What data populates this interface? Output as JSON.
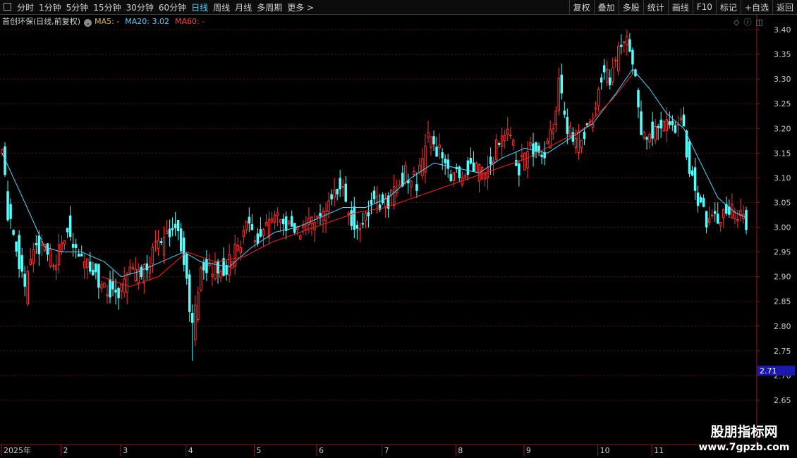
{
  "toolbar": {
    "timeframes": [
      "分时",
      "1分钟",
      "5分钟",
      "15分钟",
      "30分钟",
      "60分钟",
      "日线",
      "周线",
      "月线",
      "多周期",
      "更多 >"
    ],
    "active_timeframe": "日线",
    "right_buttons": [
      "复权",
      "叠加",
      "多股",
      "统计",
      "画线",
      "F10",
      "标记",
      "+自选",
      "返回"
    ]
  },
  "legend": {
    "title": "首创环保(日线,前复权)",
    "ma5": "MA5: -",
    "ma20": "MA20: 3.02",
    "ma60": "MA60: -"
  },
  "colors": {
    "up": "#ff3232",
    "down": "#54ffff",
    "ma20": "#4fd4ff",
    "ma60": "#ff2020",
    "axis": "#8b2020",
    "price_tag": "#1a1ab0"
  },
  "icons": [
    "menu-icon",
    "toggle-icon",
    "diamond-icon",
    "info-icon",
    "expand-icon"
  ],
  "watermark": {
    "line1": "股朋指标网",
    "line2": "www.7gpzb.com"
  },
  "chart_data": {
    "type": "candlestick",
    "title": "首创环保(日线,前复权)",
    "ylim": [
      2.6,
      3.42
    ],
    "yticks": [
      "3.40",
      "3.35",
      "3.30",
      "3.25",
      "3.20",
      "3.15",
      "3.10",
      "3.05",
      "3.00",
      "2.95",
      "2.90",
      "2.85",
      "2.80",
      "2.75",
      "2.70",
      "2.65"
    ],
    "current_price_label": "2.71",
    "current_price": 2.71,
    "x_labels": [
      {
        "label": "2025年",
        "index": 0
      },
      {
        "label": "2",
        "index": 21
      },
      {
        "label": "3",
        "index": 42
      },
      {
        "label": "4",
        "index": 65
      },
      {
        "label": "5",
        "index": 89
      },
      {
        "label": "6",
        "index": 111
      },
      {
        "label": "7",
        "index": 134
      },
      {
        "label": "8",
        "index": 160
      },
      {
        "label": "9",
        "index": 184
      },
      {
        "label": "10",
        "index": 210
      },
      {
        "label": "11",
        "index": 229
      }
    ],
    "anchors": [
      [
        0,
        3.15
      ],
      [
        2,
        3.03
      ],
      [
        5,
        2.96
      ],
      [
        8,
        2.87
      ],
      [
        11,
        2.97
      ],
      [
        15,
        2.95
      ],
      [
        19,
        2.93
      ],
      [
        23,
        3.0
      ],
      [
        26,
        2.95
      ],
      [
        29,
        2.93
      ],
      [
        33,
        2.9
      ],
      [
        37,
        2.87
      ],
      [
        41,
        2.86
      ],
      [
        45,
        2.91
      ],
      [
        49,
        2.9
      ],
      [
        53,
        2.95
      ],
      [
        57,
        2.97
      ],
      [
        61,
        3.0
      ],
      [
        64,
        2.94
      ],
      [
        67,
        2.79
      ],
      [
        70,
        2.93
      ],
      [
        74,
        2.92
      ],
      [
        78,
        2.91
      ],
      [
        82,
        2.95
      ],
      [
        86,
        3.0
      ],
      [
        90,
        2.98
      ],
      [
        94,
        3.0
      ],
      [
        98,
        3.02
      ],
      [
        102,
        3.0
      ],
      [
        106,
        3.0
      ],
      [
        110,
        3.01
      ],
      [
        113,
        3.03
      ],
      [
        116,
        3.06
      ],
      [
        119,
        3.09
      ],
      [
        122,
        3.03
      ],
      [
        125,
        3.0
      ],
      [
        128,
        3.03
      ],
      [
        131,
        3.06
      ],
      [
        134,
        3.04
      ],
      [
        138,
        3.07
      ],
      [
        142,
        3.11
      ],
      [
        146,
        3.09
      ],
      [
        150,
        3.18
      ],
      [
        154,
        3.15
      ],
      [
        158,
        3.1
      ],
      [
        162,
        3.11
      ],
      [
        166,
        3.12
      ],
      [
        170,
        3.11
      ],
      [
        174,
        3.16
      ],
      [
        178,
        3.2
      ],
      [
        182,
        3.12
      ],
      [
        186,
        3.16
      ],
      [
        190,
        3.13
      ],
      [
        194,
        3.2
      ],
      [
        196,
        3.3
      ],
      [
        198,
        3.22
      ],
      [
        201,
        3.17
      ],
      [
        205,
        3.19
      ],
      [
        208,
        3.22
      ],
      [
        211,
        3.31
      ],
      [
        214,
        3.3
      ],
      [
        217,
        3.35
      ],
      [
        220,
        3.39
      ],
      [
        223,
        3.3
      ],
      [
        225,
        3.19
      ],
      [
        229,
        3.19
      ],
      [
        233,
        3.21
      ],
      [
        237,
        3.2
      ],
      [
        239,
        3.23
      ],
      [
        242,
        3.12
      ],
      [
        245,
        3.06
      ],
      [
        248,
        3.01
      ],
      [
        252,
        3.02
      ],
      [
        256,
        3.04
      ],
      [
        259,
        3.03
      ],
      [
        262,
        3.0
      ]
    ],
    "ma20_anchors": [
      [
        0,
        3.15
      ],
      [
        8,
        3.05
      ],
      [
        15,
        2.96
      ],
      [
        21,
        2.95
      ],
      [
        28,
        2.95
      ],
      [
        36,
        2.93
      ],
      [
        42,
        2.9
      ],
      [
        48,
        2.91
      ],
      [
        56,
        2.93
      ],
      [
        64,
        2.95
      ],
      [
        70,
        2.93
      ],
      [
        80,
        2.92
      ],
      [
        88,
        2.96
      ],
      [
        96,
        2.99
      ],
      [
        104,
        3.0
      ],
      [
        112,
        3.02
      ],
      [
        120,
        3.04
      ],
      [
        128,
        3.04
      ],
      [
        136,
        3.06
      ],
      [
        144,
        3.1
      ],
      [
        152,
        3.13
      ],
      [
        160,
        3.12
      ],
      [
        168,
        3.11
      ],
      [
        176,
        3.14
      ],
      [
        184,
        3.16
      ],
      [
        192,
        3.15
      ],
      [
        200,
        3.18
      ],
      [
        208,
        3.21
      ],
      [
        216,
        3.27
      ],
      [
        222,
        3.32
      ],
      [
        228,
        3.28
      ],
      [
        234,
        3.23
      ],
      [
        240,
        3.2
      ],
      [
        246,
        3.13
      ],
      [
        252,
        3.06
      ],
      [
        258,
        3.03
      ],
      [
        262,
        3.02
      ]
    ],
    "ma60_anchors": [
      [
        35,
        2.9
      ],
      [
        45,
        2.88
      ],
      [
        55,
        2.9
      ],
      [
        65,
        2.95
      ],
      [
        75,
        2.93
      ],
      [
        85,
        2.94
      ],
      [
        95,
        2.97
      ],
      [
        105,
        2.99
      ],
      [
        115,
        3.01
      ],
      [
        125,
        3.03
      ],
      [
        135,
        3.04
      ],
      [
        145,
        3.06
      ],
      [
        155,
        3.08
      ],
      [
        165,
        3.1
      ],
      [
        175,
        3.12
      ],
      [
        185,
        3.14
      ],
      [
        195,
        3.17
      ],
      [
        205,
        3.2
      ],
      [
        215,
        3.26
      ],
      [
        222,
        3.31
      ]
    ]
  }
}
